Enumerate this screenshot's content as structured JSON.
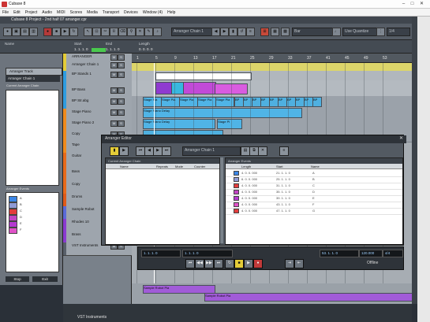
{
  "os": {
    "title": "Cubase 8",
    "min": "–",
    "max": "□",
    "close": "✕"
  },
  "menu": [
    "File",
    "Edit",
    "Project",
    "Audio",
    "MIDI",
    "Scores",
    "Media",
    "Transport",
    "Devices",
    "Window (4)",
    "Help"
  ],
  "project": {
    "title": "Cubase 8 Project - 2nd half 07 arranger.cpr"
  },
  "toolbar": {
    "chain_select": "Arranger Chain 1",
    "snap_value": "Bar",
    "quantize_label": "Use Quantize",
    "quantize_value": "1/4",
    "brand": "steinberg"
  },
  "info": {
    "name_label": "Name",
    "start_label": "Start",
    "end_label": "End",
    "length_label": "Length",
    "start_value": "1. 1. 1. 0",
    "end_value": "1. 1. 1. 0",
    "length_value": "0. 0. 0. 0"
  },
  "left_panel": {
    "track_label": "Arranger Track",
    "chain_value": "Arranger Chain 1",
    "current_chain_label": "Current Arranger Chain",
    "events_label": "Arranger Events",
    "events": [
      {
        "name": "A",
        "color": "#3b86e6"
      },
      {
        "name": "B",
        "color": "#8f9bd6"
      },
      {
        "name": "C",
        "color": "#e23c3c"
      },
      {
        "name": "D",
        "color": "#c244c4"
      },
      {
        "name": "E",
        "color": "#b43ad0"
      },
      {
        "name": "F",
        "color": "#e052c8"
      }
    ],
    "stop_label": "Stop",
    "exit_label": "Exit"
  },
  "tracks": [
    {
      "name": "ARRANGER",
      "color": "#e4cc38"
    },
    {
      "name": "Arranger Chain 1",
      "color": "#e4cc38"
    },
    {
      "name": "BP Stands 1",
      "color": "#2f9ce0"
    },
    {
      "name": "BP Bass",
      "color": "#2f9ce0"
    },
    {
      "name": "BP Str.abg",
      "color": "#2f9ce0"
    },
    {
      "name": "Stage Piano",
      "color": "#f08a1c"
    },
    {
      "name": "Stage Piano 2",
      "color": "#f08a1c"
    },
    {
      "name": "Copy",
      "color": "#f08a1c"
    },
    {
      "name": "Tape",
      "color": "#f08a1c"
    },
    {
      "name": "Guitar",
      "color": "#e86a1a"
    },
    {
      "name": "Bass",
      "color": "#e86a1a"
    },
    {
      "name": "Copy",
      "color": "#e86a1a"
    },
    {
      "name": "Drums",
      "color": "#e05a18"
    },
    {
      "name": "Sample Robot",
      "color": "#5a6bd8"
    },
    {
      "name": "Rhodes 10",
      "color": "#8a3ad0"
    },
    {
      "name": "Brass",
      "color": "#8a3ad0"
    },
    {
      "name": "VST Instruments",
      "color": "#58606a"
    }
  ],
  "ruler": [
    {
      "label": "1"
    },
    {
      "label": "5"
    },
    {
      "label": "9"
    },
    {
      "label": "13"
    },
    {
      "label": "17"
    },
    {
      "label": "21"
    },
    {
      "label": "25"
    },
    {
      "label": "29"
    },
    {
      "label": "33"
    },
    {
      "label": "37"
    },
    {
      "label": "41"
    },
    {
      "label": "45"
    },
    {
      "label": "49"
    },
    {
      "label": "53"
    }
  ],
  "lanes": {
    "stage_events": [
      "Stage Pia",
      "Stage Pia",
      "Stage Pia",
      "Stage Pia",
      "Stage Pia"
    ],
    "stage_piano_event": "Stage Piano Delay",
    "stage_piano_event_2": "Stage Piano Delay",
    "stage_tail": "Stage Pi",
    "midi_events": [
      "BP",
      "BP",
      "BP",
      "BP",
      "BP",
      "BP",
      "BP",
      "BP",
      "BP",
      "BP"
    ]
  },
  "arranger_editor": {
    "title": "Arranger Editor",
    "chain_select": "Arranger Chain 1",
    "current_chain_header": "Current Arranger Chain",
    "chain_columns": [
      "Name",
      "Repeats",
      "Mode",
      "Counter"
    ],
    "events_header": "Arranger Events",
    "event_columns": [
      "Length",
      "Start",
      "Name"
    ],
    "events": [
      {
        "length": "4. 0. 0. 000",
        "start": "21. 1. 1. 0",
        "name": "A",
        "color": "#3b86e6"
      },
      {
        "length": "6. 0. 0. 000",
        "start": "25. 1. 1. 0",
        "name": "B",
        "color": "#8f9bd6"
      },
      {
        "length": "4. 0. 0. 000",
        "start": "31. 1. 1. 0",
        "name": "C",
        "color": "#e23c3c"
      },
      {
        "length": "4. 0. 0. 000",
        "start": "35. 1. 1. 0",
        "name": "D",
        "color": "#c244c4"
      },
      {
        "length": "4. 0. 0. 000",
        "start": "39. 1. 1. 0",
        "name": "E",
        "color": "#b43ad0"
      },
      {
        "length": "4. 0. 0. 000",
        "start": "43. 1. 1. 0",
        "name": "F",
        "color": "#e052c8"
      },
      {
        "length": "4. 0. 0. 000",
        "start": "47. 1. 1. 0",
        "name": "G",
        "color": "#e23c3c"
      }
    ]
  },
  "transport": {
    "position": "1. 1. 1. 0",
    "left_locator": "1. 1. 1. 0",
    "right_locator": "53. 1. 1. 0",
    "tempo": "120.000",
    "sig": "4/4",
    "offline_label": "Offline"
  },
  "bottom_lane": {
    "events": [
      "Sample Robot Pia",
      "Sample Robot Pia"
    ],
    "tracks_label": "VST Instruments"
  },
  "colors": {
    "accent": "#e4cc38",
    "audio": "#50b4e6",
    "selection": "#f08a1c",
    "midi": "#a15bd8"
  }
}
